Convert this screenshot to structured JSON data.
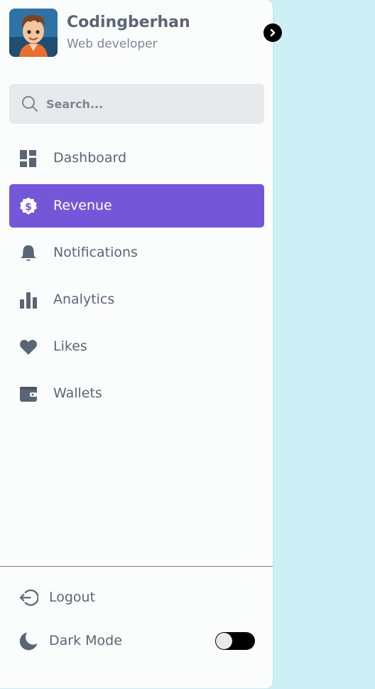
{
  "profile": {
    "name": "Codingberhan",
    "role": "Web developer"
  },
  "search": {
    "placeholder": "Search..."
  },
  "menu": [
    {
      "label": "Dashboard",
      "icon": "dashboard-icon"
    },
    {
      "label": "Revenue",
      "icon": "dollar-badge-icon",
      "active": true
    },
    {
      "label": "Notifications",
      "icon": "bell-icon"
    },
    {
      "label": "Analytics",
      "icon": "bar-chart-icon"
    },
    {
      "label": "Likes",
      "icon": "heart-icon"
    },
    {
      "label": "Wallets",
      "icon": "wallet-icon"
    }
  ],
  "bottom": {
    "logout_label": "Logout",
    "dark_mode_label": "Dark Mode",
    "dark_mode_on": false
  },
  "colors": {
    "background": "#cdeff6",
    "sidebar": "#fbfdfc",
    "accent": "#7457d8",
    "text": "#5b6674",
    "search_bg": "#e8e9ec"
  }
}
